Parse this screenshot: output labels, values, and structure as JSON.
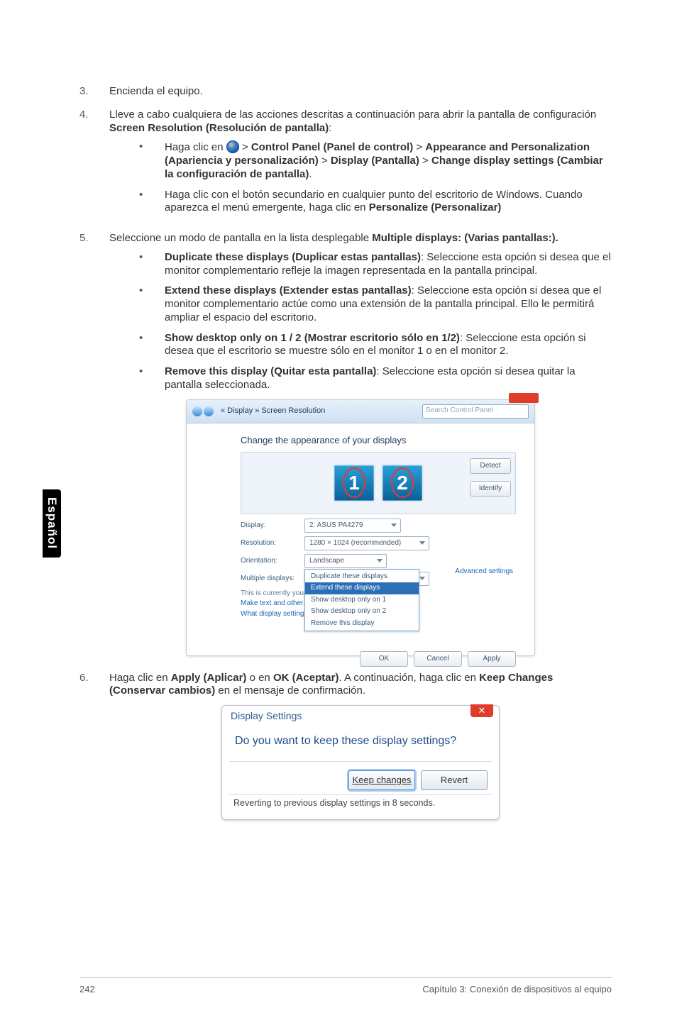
{
  "sidetab": "Español",
  "steps": {
    "s3": {
      "num": "3.",
      "text": "Encienda el equipo."
    },
    "s4": {
      "num": "4.",
      "lead": "Lleve a cabo cualquiera de las acciones descritas a continuación para abrir la pantalla de configuración ",
      "bold": "Screen Resolution (Resolución de pantalla)",
      "tail": ":"
    },
    "s4a": {
      "pre": "Haga clic en ",
      "seg1": " > ",
      "b1": "Control Panel (Panel de control)",
      "seg2": " > ",
      "b2": "Appearance and Personalization (Apariencia y personalización)",
      "seg3": " > ",
      "b3": "Display (Pantalla)",
      "seg4": " > ",
      "b4": "Change display settings (Cambiar la configuración de pantalla)",
      "end": "."
    },
    "s4b": {
      "t1": "Haga clic con el botón secundario en cualquier punto del escritorio de Windows. Cuando aparezca el menú emergente, haga clic en ",
      "b": "Personalize (Personalizar)"
    },
    "s5": {
      "num": "5.",
      "t1": "Seleccione un modo de pantalla en la lista desplegable ",
      "b": "Multiple displays: (Varias pantallas:)."
    },
    "s5a": {
      "b": "Duplicate these displays (Duplicar estas pantallas)",
      "t": ": Seleccione esta opción si desea que el monitor complementario refleje la imagen representada en la pantalla principal."
    },
    "s5b": {
      "b": "Extend these displays (Extender estas pantallas)",
      "t": ": Seleccione esta opción si desea que el monitor complementario actúe como una extensión de la pantalla principal. Ello le permitirá ampliar el espacio del escritorio."
    },
    "s5c": {
      "b": "Show desktop only on 1 / 2 (Mostrar escritorio sólo en 1/2)",
      "t": ": Seleccione esta opción si desea que el escritorio se muestre sólo en el monitor 1 o en el monitor 2."
    },
    "s5d": {
      "b": "Remove this display (Quitar esta pantalla)",
      "t": ": Seleccione esta opción si desea quitar la pantalla seleccionada."
    },
    "s6": {
      "num": "6.",
      "t1": "Haga clic en ",
      "b1": "Apply (Aplicar)",
      "t2": " o en ",
      "b2": "OK (Aceptar)",
      "t3": ". A continuación, haga clic en ",
      "b3": "Keep Changes (Conservar cambios)",
      "t4": " en el mensaje de confirmación."
    }
  },
  "ss1": {
    "path": "« Display » Screen Resolution",
    "search": "Search Control Panel",
    "heading": "Change the appearance of your displays",
    "mon1": "1",
    "mon2": "2",
    "detect": "Detect",
    "identify": "Identify",
    "rows": {
      "display": {
        "lbl": "Display:",
        "val": "2. ASUS PA4279"
      },
      "resolution": {
        "lbl": "Resolution:",
        "val": "1280 × 1024 (recommended)"
      },
      "orientation": {
        "lbl": "Orientation:",
        "val": "Landscape"
      },
      "multiple": {
        "lbl": "Multiple displays:",
        "val": "Duplicate these displays"
      }
    },
    "menu": {
      "i0": "Duplicate these displays",
      "i1": "Extend these displays",
      "i2": "Show desktop only on 1",
      "i3": "Show desktop only on 2",
      "i4": "Remove this display"
    },
    "note1": "This is currently your main display.",
    "note2a": "Make text and other items larger or smaller",
    "note2b": "What display settings should I choose?",
    "adv": "Advanced settings",
    "ok": "OK",
    "cancel": "Cancel",
    "apply": "Apply"
  },
  "ss2": {
    "title": "Display Settings",
    "close": "✕",
    "question": "Do you want to keep these display settings?",
    "keep": "Keep changes",
    "revert": "Revert",
    "footer": "Reverting to previous display settings in 8 seconds."
  },
  "footer": {
    "page": "242",
    "chapter": "Capítulo 3: Conexión de dispositivos al equipo"
  }
}
